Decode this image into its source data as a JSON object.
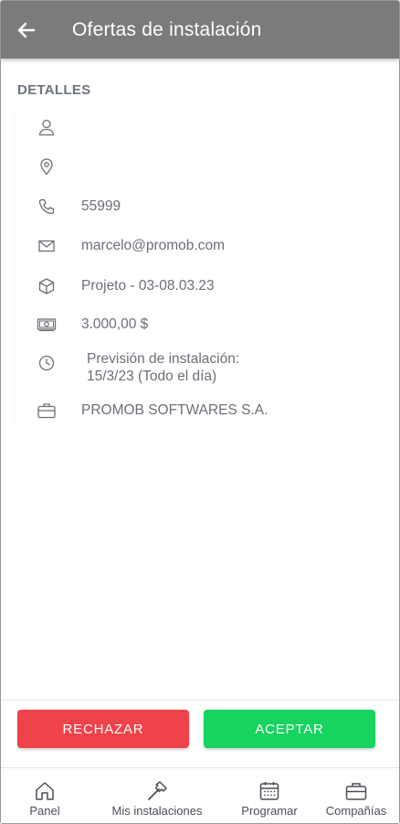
{
  "header": {
    "title": "Ofertas de instalación",
    "back_icon": "arrow-left-icon"
  },
  "details": {
    "section_title": "DETALLES",
    "rows": [
      {
        "icon": "user-icon",
        "text": ""
      },
      {
        "icon": "location-pin-icon",
        "text": ""
      },
      {
        "icon": "phone-icon",
        "text": "55999"
      },
      {
        "icon": "email-icon",
        "text": "marcelo@promob.com"
      },
      {
        "icon": "box-icon",
        "text": "Projeto - 03-08.03.23"
      },
      {
        "icon": "money-icon",
        "text": "3.000,00 $"
      },
      {
        "icon": "clock-icon",
        "line1": "Previsión de instalación:",
        "line2": "15/3/23 (Todo el día)"
      },
      {
        "icon": "briefcase-icon",
        "text": "PROMOB SOFTWARES S.A."
      }
    ]
  },
  "actions": {
    "reject_label": "RECHAZAR",
    "accept_label": "ACEPTAR"
  },
  "nav": {
    "items": [
      {
        "icon": "home-icon",
        "label": "Panel"
      },
      {
        "icon": "hammer-icon",
        "label": "Mis instalaciones"
      },
      {
        "icon": "calendar-icon",
        "label": "Programar"
      },
      {
        "icon": "briefcase-icon",
        "label": "Compañías"
      }
    ]
  },
  "colors": {
    "appbar": "#7a7b7d",
    "reject": "#f0424a",
    "accept": "#17d35f",
    "text_muted": "#6b6f78"
  }
}
